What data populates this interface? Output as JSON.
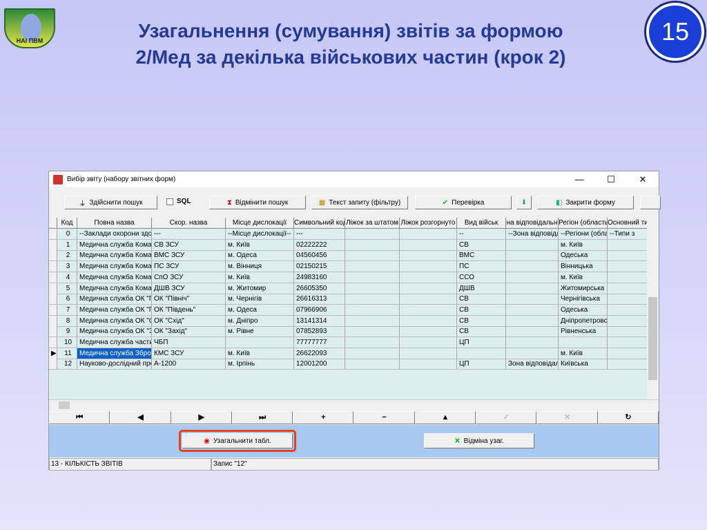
{
  "slide": {
    "title_line1": "Узагальнення (сумування) звітів за формою",
    "title_line2": "2/Мед за декілька військових частин (крок 2)",
    "number": "15",
    "logo_text": "НАІ ПВМ"
  },
  "window": {
    "title": "Вибір звіту (набору звітних форм)",
    "minimize": "—",
    "maximize": "☐",
    "close": "✕"
  },
  "toolbar": {
    "search": "Здійснити пошук",
    "sql": "SQL",
    "cancel_search": "Відмінити пошук",
    "query_text": "Текст запиту (фільтру)",
    "check": "Перевірка",
    "close_form": "Закрити форму"
  },
  "grid": {
    "columns": [
      "Код",
      "Повна назва",
      "Скор. назва",
      "Місце дислокації",
      "Символьний код",
      "Ліжок за штатом",
      "Ліжок розгорнуто",
      "Вид військ",
      "на відповідальн",
      "Регіон (область",
      "Основний тип"
    ],
    "rows": [
      [
        "0",
        "--Заклади охорони здор",
        "---",
        "--Місце дислокації--",
        "---",
        "",
        "",
        "--",
        "--Зона відповіда",
        "--Регіони (облас",
        "--Типи з"
      ],
      [
        "1",
        "Медична служба Коман",
        "СВ ЗСУ",
        "м. Київ",
        "02222222",
        "",
        "",
        "СВ",
        "",
        "м. Київ",
        ""
      ],
      [
        "2",
        "Медична служба Коман",
        "ВМС ЗСУ",
        "м. Одеса",
        "04560456",
        "",
        "",
        "ВМС",
        "",
        "Одеська",
        ""
      ],
      [
        "3",
        "Медична служба Коман",
        "ПС ЗСУ",
        "м. Вінниця",
        "02150215",
        "",
        "",
        "ПС",
        "",
        "Вінницька",
        ""
      ],
      [
        "4",
        "Медична служба Коман",
        "СпО ЗСУ",
        "м. Київ",
        "24983160",
        "",
        "",
        "ССО",
        "",
        "м. Київ",
        ""
      ],
      [
        "5",
        "Медична служба Коман",
        "ДШВ ЗСУ",
        "м. Житомир",
        "26605350",
        "",
        "",
        "ДШВ",
        "",
        "Житомирська",
        ""
      ],
      [
        "6",
        "Медична служба ОК \"П",
        "ОК \"Північ\"",
        "м. Чернігів",
        "26616313",
        "",
        "",
        "СВ",
        "",
        "Чернігівська",
        ""
      ],
      [
        "7",
        "Медична служба ОК \"П",
        "ОК \"Південь\"",
        "м. Одеса",
        "07966906",
        "",
        "",
        "СВ",
        "",
        "Одеська",
        ""
      ],
      [
        "8",
        "Медична служба ОК \"С",
        "ОК \"Схід\"",
        "м. Дніпро",
        "13141314",
        "",
        "",
        "СВ",
        "",
        "Дніпропетровсі",
        ""
      ],
      [
        "9",
        "Медична служба ОК \"З",
        "ОК \"Захід\"",
        "м. Рівне",
        "07852893",
        "",
        "",
        "СВ",
        "",
        "Рівненська",
        ""
      ],
      [
        "10",
        "Медична служба части",
        "ЧБП",
        "",
        "77777777",
        "",
        "",
        "ЦП",
        "",
        "",
        ""
      ],
      [
        "11",
        "Медична служба Збройі",
        "КМС ЗСУ",
        "м. Київ",
        "26622093",
        "",
        "",
        "",
        "",
        "м. Київ",
        ""
      ],
      [
        "12",
        "Науково-дослідний про",
        "А-1200",
        "м. Ірпінь",
        "12001200",
        "",
        "",
        "ЦП",
        "Зона відповідалі",
        "Київська",
        ""
      ]
    ],
    "selected_row": 11
  },
  "nav": [
    "⏮",
    "◀",
    "▶",
    "⏭",
    "+",
    "−",
    "▲",
    "✓",
    "✕",
    "↻"
  ],
  "actions": {
    "summarize": "Узагальнити табл.",
    "cancel_summary": "Відміна узаг."
  },
  "status": {
    "count": "13 - КІЛЬКІСТЬ ЗВІТІВ",
    "record": "Запис \"12\""
  },
  "colors": {
    "highlight": "#e8401c",
    "panel": "#a7c9f0",
    "grid": "#dcefec"
  }
}
